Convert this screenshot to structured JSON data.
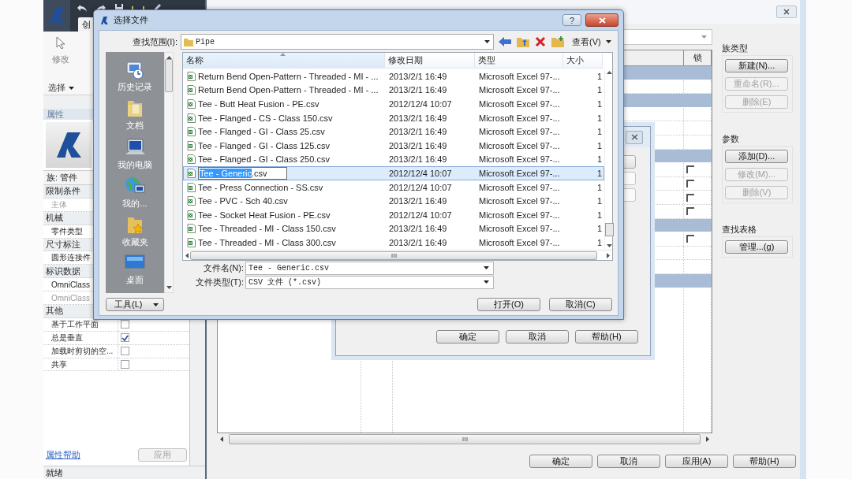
{
  "app": {
    "ribbon_tab": "创",
    "modify_label": "修改",
    "select_menu": "选择",
    "properties_title": "属性",
    "type_selector": "族: 管件",
    "properties": [
      {
        "kind": "group",
        "label": "限制条件"
      },
      {
        "kind": "row",
        "label": "主体",
        "disabled": true
      },
      {
        "kind": "group",
        "label": "机械"
      },
      {
        "kind": "row",
        "label": "零件类型",
        "disabled": false
      },
      {
        "kind": "group",
        "label": "尺寸标注"
      },
      {
        "kind": "row",
        "label": "圆形连接件",
        "disabled": false
      },
      {
        "kind": "group",
        "label": "标识数据"
      },
      {
        "kind": "row",
        "label": "OmniClass",
        "disabled": false
      },
      {
        "kind": "row",
        "label": "OmniClass",
        "disabled": true
      },
      {
        "kind": "group",
        "label": "其他"
      },
      {
        "kind": "check",
        "label": "基于工作平面",
        "checked": false
      },
      {
        "kind": "check",
        "label": "总是垂直",
        "checked": true
      },
      {
        "kind": "check",
        "label": "加载时剪切的空...",
        "checked": false
      },
      {
        "kind": "check",
        "label": "共享",
        "checked": false
      }
    ],
    "help_link": "属性帮助",
    "apply_button": {
      "label": "应用",
      "disabled": true
    },
    "status": "就绪"
  },
  "family_dialog": {
    "lock_column": "锁",
    "table_rows": [
      {
        "kind": "group"
      },
      {
        "kind": "row"
      },
      {
        "kind": "group"
      },
      {
        "kind": "row"
      },
      {
        "kind": "row"
      },
      {
        "kind": "row"
      },
      {
        "kind": "group"
      },
      {
        "kind": "check",
        "checked": false
      },
      {
        "kind": "check",
        "checked": false
      },
      {
        "kind": "check",
        "checked": false
      },
      {
        "kind": "check",
        "checked": false
      },
      {
        "kind": "group"
      },
      {
        "kind": "check",
        "checked": false
      },
      {
        "kind": "row"
      },
      {
        "kind": "row"
      },
      {
        "kind": "group"
      }
    ],
    "type_group": {
      "title": "族类型",
      "buttons": [
        {
          "label": "新建(N)...",
          "disabled": false
        },
        {
          "label": "重命名(R)...",
          "disabled": true
        },
        {
          "label": "删除(E)",
          "disabled": true
        }
      ]
    },
    "param_group": {
      "title": "参数",
      "buttons": [
        {
          "label": "添加(D)...",
          "disabled": false
        },
        {
          "label": "修改(M)...",
          "disabled": true
        },
        {
          "label": "删除(V)",
          "disabled": true
        }
      ]
    },
    "lookup_group": {
      "title": "查找表格",
      "buttons": [
        {
          "label": "管理...(g)",
          "disabled": false
        }
      ]
    },
    "buttons": [
      "确定",
      "取消",
      "应用(A)",
      "帮助(H)"
    ]
  },
  "middle_dialog": {
    "buttons": [
      "确定",
      "取消",
      "帮助(H)"
    ]
  },
  "file_dialog": {
    "title": "选择文件",
    "help_button": "?",
    "look_in_label": "查找范围(I):",
    "look_in": "Pipe",
    "view_menu": "查看(V)",
    "places": [
      {
        "kind": "history",
        "label": "历史记录"
      },
      {
        "kind": "documents",
        "label": "文档"
      },
      {
        "kind": "computer",
        "label": "我的电脑"
      },
      {
        "kind": "network",
        "label": "我的..."
      },
      {
        "kind": "favorites",
        "label": "收藏夹"
      },
      {
        "kind": "desktop",
        "label": "桌面"
      }
    ],
    "tools_button": "工具(L)",
    "columns": [
      "名称",
      "修改日期",
      "类型",
      "大小"
    ],
    "files": [
      {
        "name": "Return Bend Open-Pattern - Threaded - MI - ...",
        "date": "2013/2/1 16:49",
        "type": "Microsoft Excel 97-...",
        "size": "1",
        "selected": false
      },
      {
        "name": "Return Bend Open-Pattern - Threaded - MI - ...",
        "date": "2013/2/1 16:49",
        "type": "Microsoft Excel 97-...",
        "size": "1",
        "selected": false
      },
      {
        "name": "Tee - Butt Heat Fusion - PE.csv",
        "date": "2012/12/4 10:07",
        "type": "Microsoft Excel 97-...",
        "size": "1",
        "selected": false
      },
      {
        "name": "Tee - Flanged - CS - Class 150.csv",
        "date": "2013/2/1 16:49",
        "type": "Microsoft Excel 97-...",
        "size": "1",
        "selected": false
      },
      {
        "name": "Tee - Flanged - GI - Class 25.csv",
        "date": "2013/2/1 16:49",
        "type": "Microsoft Excel 97-...",
        "size": "1",
        "selected": false
      },
      {
        "name": "Tee - Flanged - GI - Class 125.csv",
        "date": "2013/2/1 16:49",
        "type": "Microsoft Excel 97-...",
        "size": "1",
        "selected": false
      },
      {
        "name": "Tee - Flanged - GI - Class 250.csv",
        "date": "2013/2/1 16:49",
        "type": "Microsoft Excel 97-...",
        "size": "1",
        "selected": false
      },
      {
        "rename": {
          "selected_text": "Tee - Generic",
          "rest": ".csv"
        },
        "date": "2012/12/4 10:07",
        "type": "Microsoft Excel 97-...",
        "size": "1",
        "selected": true
      },
      {
        "name": "Tee - Press Connection - SS.csv",
        "date": "2012/12/4 10:07",
        "type": "Microsoft Excel 97-...",
        "size": "1",
        "selected": false
      },
      {
        "name": "Tee - PVC - Sch 40.csv",
        "date": "2013/2/1 16:49",
        "type": "Microsoft Excel 97-...",
        "size": "1",
        "selected": false
      },
      {
        "name": "Tee - Socket Heat Fusion - PE.csv",
        "date": "2012/12/4 10:07",
        "type": "Microsoft Excel 97-...",
        "size": "1",
        "selected": false
      },
      {
        "name": "Tee - Threaded - MI - Class 150.csv",
        "date": "2013/2/1 16:49",
        "type": "Microsoft Excel 97-...",
        "size": "1",
        "selected": false
      },
      {
        "name": "Tee - Threaded - MI - Class 300.csv",
        "date": "2013/2/1 16:49",
        "type": "Microsoft Excel 97-...",
        "size": "1",
        "selected": false
      }
    ],
    "filename_label": "文件名(N):",
    "filename": "Tee - Generic.csv",
    "filetype_label": "文件类型(T):",
    "filetype": "CSV 文件 (*.csv)",
    "open_button": "打开(O)",
    "cancel_button": "取消(C)"
  }
}
